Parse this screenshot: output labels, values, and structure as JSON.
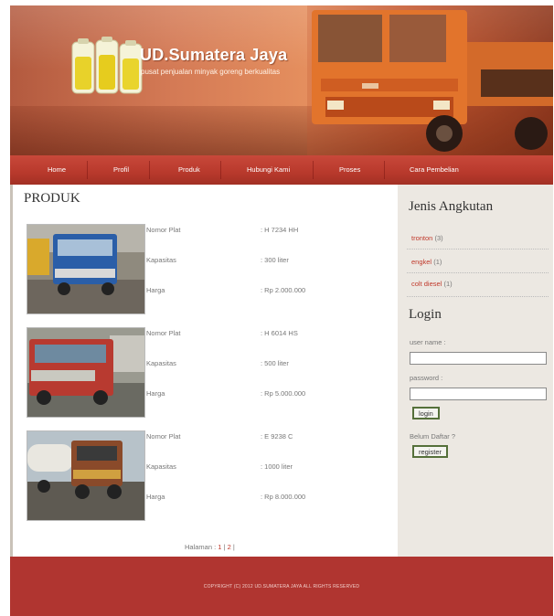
{
  "header": {
    "title": "UD.Sumatera Jaya",
    "tagline": "pusat penjualan minyak goreng berkualitas"
  },
  "nav": {
    "items": [
      {
        "label": "Home"
      },
      {
        "label": "Profil"
      },
      {
        "label": "Produk"
      },
      {
        "label": "Hubungi Kami"
      },
      {
        "label": "Proses"
      },
      {
        "label": "Cara Pembelian"
      }
    ]
  },
  "main": {
    "heading": "PRODUK",
    "labels": {
      "plate": "Nomor Plat",
      "capacity": "Kapasitas",
      "price": "Harga"
    },
    "products": [
      {
        "plate": ": H 7234 HH",
        "capacity": ": 300 liter",
        "price": ": Rp 2.000.000"
      },
      {
        "plate": ": H 6014 HS",
        "capacity": ": 500 liter",
        "price": ": Rp 5.000.000"
      },
      {
        "plate": ": E 9238 C",
        "capacity": ": 1000 liter",
        "price": ": Rp 8.000.000"
      }
    ],
    "pagination": {
      "label": "Halaman : ",
      "pages": [
        "1",
        "2"
      ]
    }
  },
  "sidebar": {
    "categories_title": "Jenis Angkutan",
    "categories": [
      {
        "name": "tronton",
        "count": "(3)"
      },
      {
        "name": "engkel",
        "count": "(1)"
      },
      {
        "name": "colt diesel",
        "count": "(1)"
      }
    ],
    "login": {
      "title": "Login",
      "username_label": "user name :",
      "password_label": "password :",
      "login_button": "login",
      "signup_prompt": "Belum Daftar ?",
      "register_button": "register"
    }
  },
  "footer": {
    "copyright": "COPYRIGHT (C) 2012 UD.SUMATERA JAYA ALL RIGHTS RESERVED"
  },
  "colors": {
    "nav": "#b8392c",
    "footer": "#b03530",
    "link": "#c0392b",
    "sidebar_bg": "#ece8e2"
  }
}
